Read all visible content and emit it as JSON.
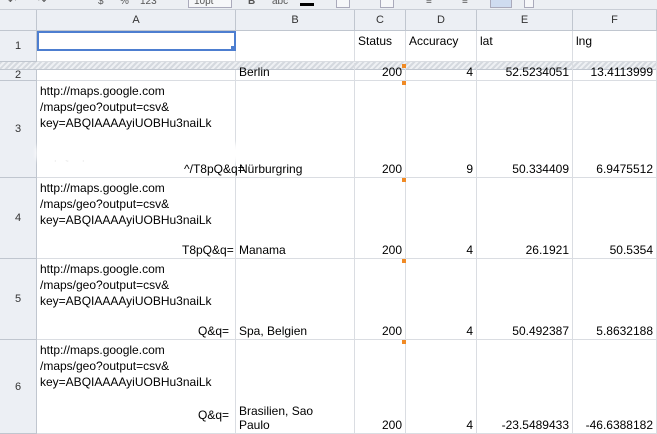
{
  "toolbar": {
    "font_size": "10pt",
    "number_format_pct": "%",
    "number_format_123": "123"
  },
  "columns": [
    "A",
    "B",
    "C",
    "D",
    "E",
    "F"
  ],
  "rows": [
    "1",
    "2",
    "3",
    "4",
    "5",
    "6"
  ],
  "header_row": {
    "a": "",
    "b": "",
    "c": "Status",
    "d": "Accuracy",
    "e": "lat",
    "f": "lng"
  },
  "data": [
    {
      "a": "",
      "b": "Berlin",
      "c": "200",
      "d": "4",
      "e": "52.5234051",
      "f": "13.4113999"
    },
    {
      "a": "http://maps.google.com\n/maps/geo?output=csv&\nkey=ABQIAAAAyiUOBHu3naiLk\n\n           T8pQ&q=",
      "a_tail": "^/T8pQ&q=",
      "b": "Nürburgring",
      "c": "200",
      "d": "9",
      "e": "50.334409",
      "f": "6.9475512"
    },
    {
      "a": "http://maps.google.com\n/maps/geo?output=csv&\nkey=ABQIAAAAyiUOBHu3naiLk\n\n",
      "a_tail": "T8pQ&q=",
      "b": "Manama",
      "c": "200",
      "d": "4",
      "e": "26.1921",
      "f": "50.5354"
    },
    {
      "a": "http://maps.google.com\n/maps/geo?output=csv&\nkey=ABQIAAAAyiUOBHu3naiLk\n\n",
      "a_tail": "Q&q=",
      "b": "Spa, Belgien",
      "c": "200",
      "d": "4",
      "e": "50.492387",
      "f": "5.8632188"
    },
    {
      "a": "http://maps.google.com\n/maps/geo?output=csv&\nkey=ABQIAAAAyiUOBHu3naiLk\n\n",
      "a_tail": "Q&q=",
      "b": "Brasilien, Sao\nPaulo",
      "c": "200",
      "d": "4",
      "e": "-23.5489433",
      "f": "-46.6388182"
    }
  ],
  "colors": {
    "selection": "#4d7ed0",
    "note_marker": "#f08a24",
    "header_bg": "#eceff4"
  }
}
